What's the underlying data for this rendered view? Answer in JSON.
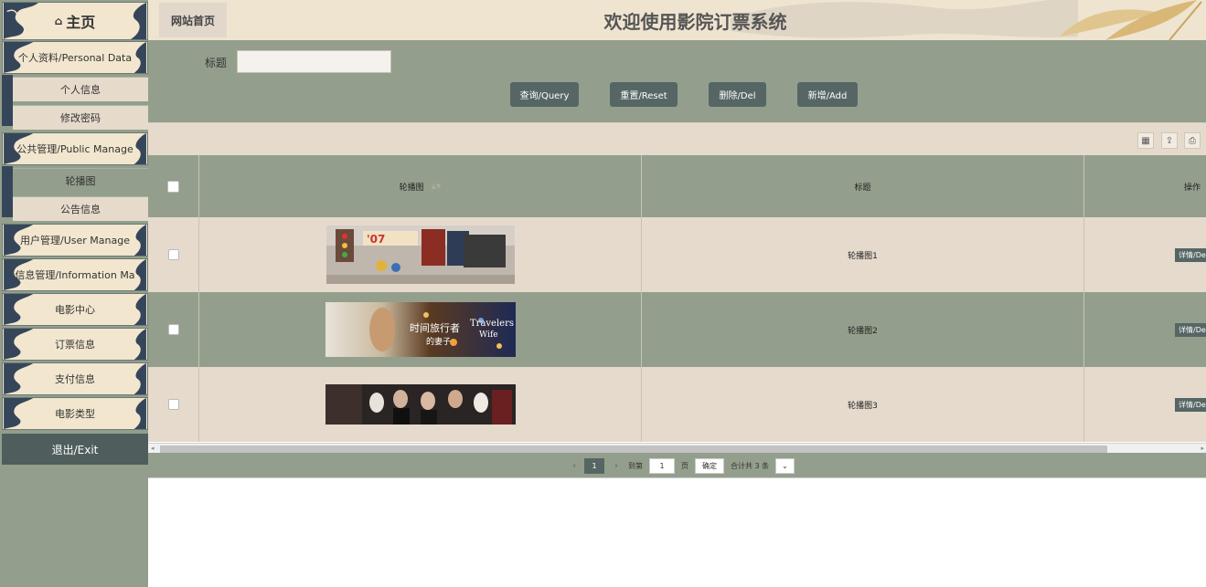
{
  "app": {
    "title": "欢迎使用影院订票系统",
    "breadcrumb": "网站首页"
  },
  "sidebar": {
    "home": "主页",
    "home_icon": "home-icon",
    "groups": [
      {
        "label": "个人资料/Personal Data",
        "subs": [
          "个人信息",
          "修改密码"
        ]
      },
      {
        "label": "公共管理/Public Manage",
        "subs": [
          "轮播图",
          "公告信息"
        ]
      },
      {
        "label": "用户管理/User Manage",
        "subs": []
      },
      {
        "label": "信息管理/Information Ma",
        "subs": []
      }
    ],
    "items": [
      "电影中心",
      "订票信息",
      "支付信息",
      "电影类型"
    ],
    "exit": "退出/Exit"
  },
  "search": {
    "label": "标题",
    "value": "",
    "buttons": {
      "query": "查询/Query",
      "reset": "重置/Reset",
      "delete": "删除/Del",
      "add": "新增/Add"
    }
  },
  "toolbar": {
    "icons": [
      "columns-icon",
      "export-icon",
      "print-icon"
    ]
  },
  "table": {
    "columns": [
      "轮播图",
      "标题",
      "操作"
    ],
    "rows": [
      {
        "title": "轮播图1",
        "action": "详情/Det"
      },
      {
        "title": "轮播图2",
        "action": "详情/Det"
      },
      {
        "title": "轮播图3",
        "action": "详情/Det"
      }
    ]
  },
  "pagination": {
    "current": "1",
    "goto_prefix": "到第",
    "goto_value": "1",
    "goto_suffix": "页",
    "confirm": "确定",
    "total": "合计共 3 条"
  },
  "colors": {
    "sage": "#939f8c",
    "cream": "#e5dacc",
    "button": "#566665",
    "navy_wave": "#36465a"
  }
}
